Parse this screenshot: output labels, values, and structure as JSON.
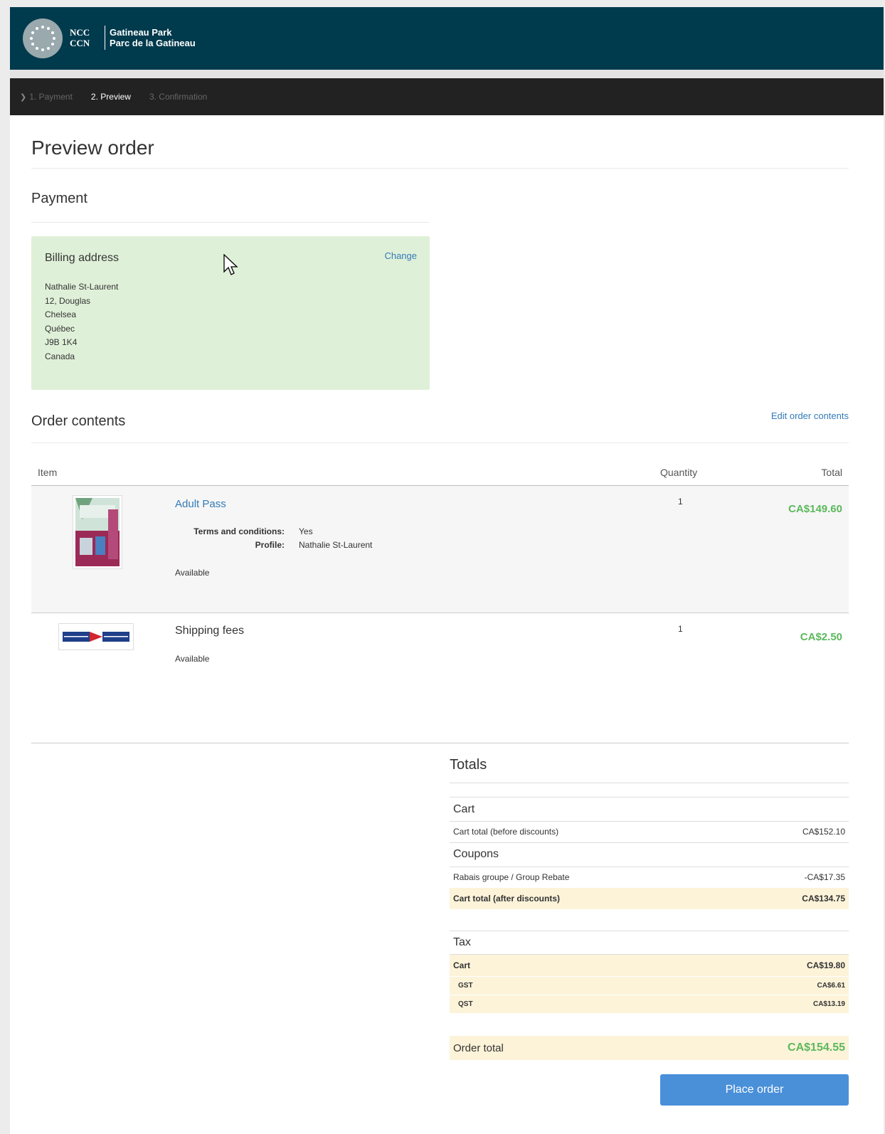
{
  "header": {
    "logo_ncc_line1": "NCC",
    "logo_ncc_line2": "CCN",
    "park_line1": "Gatineau Park",
    "park_line2": "Parc de la Gatineau"
  },
  "steps": [
    {
      "label": "1. Payment",
      "state": "done"
    },
    {
      "label": "2. Preview",
      "state": "active"
    },
    {
      "label": "3. Confirmation",
      "state": "pending"
    }
  ],
  "page_title": "Preview order",
  "payment": {
    "heading": "Payment",
    "billing_title": "Billing address",
    "change_label": "Change",
    "address_lines": [
      "Nathalie St-Laurent",
      "12, Douglas",
      "Chelsea",
      "Québec",
      "J9B 1K4",
      "Canada"
    ]
  },
  "order": {
    "heading": "Order contents",
    "edit_label": "Edit order contents",
    "columns": {
      "item": "Item",
      "quantity": "Quantity",
      "total": "Total"
    },
    "items": [
      {
        "name": "Adult Pass",
        "terms_label": "Terms and conditions:",
        "terms_value": "Yes",
        "profile_label": "Profile:",
        "profile_value": "Nathalie St-Laurent",
        "availability": "Available",
        "quantity": "1",
        "total": "CA$149.60"
      },
      {
        "name": "Shipping fees",
        "availability": "Available",
        "quantity": "1",
        "total": "CA$2.50"
      }
    ]
  },
  "totals": {
    "heading": "Totals",
    "cart_section": "Cart",
    "cart_before_label": "Cart total (before discounts)",
    "cart_before_value": "CA$152.10",
    "coupons_section": "Coupons",
    "rebate_label": "Rabais groupe / Group Rebate",
    "rebate_value": "-CA$17.35",
    "cart_after_label": "Cart total (after discounts)",
    "cart_after_value": "CA$134.75",
    "tax_section": "Tax",
    "tax_cart_label": "Cart",
    "tax_cart_value": "CA$19.80",
    "gst_label": "GST",
    "gst_value": "CA$6.61",
    "qst_label": "QST",
    "qst_value": "CA$13.19",
    "order_total_label": "Order total",
    "order_total_value": "CA$154.55"
  },
  "place_order_label": "Place order",
  "colors": {
    "header_bg": "#003a4d",
    "steps_bg": "#222222",
    "billing_bg": "#dff0d8",
    "link": "#337ab7",
    "price_green": "#5cb85c",
    "highlight_row": "#fcf3d9",
    "button": "#4a90d9"
  }
}
